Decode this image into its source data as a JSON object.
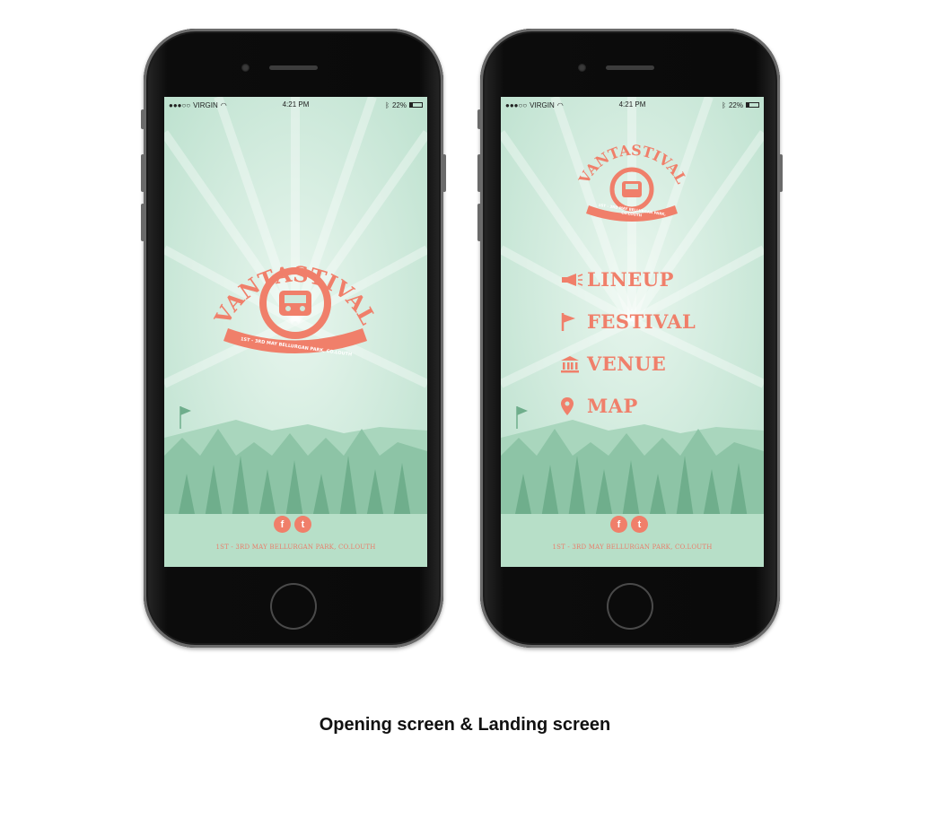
{
  "caption": "Opening screen & Landing  screen",
  "status_bar": {
    "carrier": "VIRGIN",
    "signal_text": "●●●○○",
    "time": "4:21 PM",
    "battery": "22%"
  },
  "logo": {
    "title": "VANTASTIVAL",
    "banner": "1ST - 3RD MAY BELLURGAN PARK, CO.LOUTH"
  },
  "footer": {
    "text": "1ST - 3RD MAY BELLURGAN PARK, CO.LOUTH",
    "social_facebook": "f",
    "social_twitter": "t"
  },
  "menu": {
    "items": [
      {
        "label": "LINEUP",
        "icon": "megaphone-icon"
      },
      {
        "label": "FESTIVAL",
        "icon": "flag-icon"
      },
      {
        "label": "VENUE",
        "icon": "building-icon"
      },
      {
        "label": "MAP",
        "icon": "map-pin-icon"
      }
    ]
  },
  "colors": {
    "accent": "#f07f6a",
    "background": "#cfe9dc",
    "trees": "#8dc4a6"
  }
}
